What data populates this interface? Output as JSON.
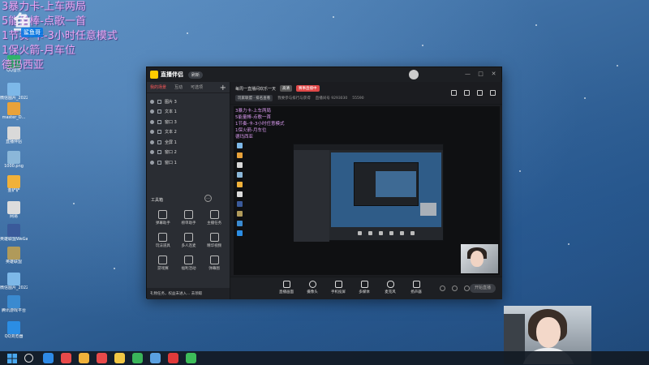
{
  "overlay": {
    "lines": [
      "3暴力卡-上车两局",
      "5能量棒-点歌一首",
      "1节奏-卡-3小时任意模式",
      "1保火箭-月车位",
      "德玛西亚"
    ],
    "logo_text": "鱼",
    "logo_tag": "鲨鱼哥"
  },
  "desktop_icons": [
    {
      "label": "QQ音乐",
      "color": "#2fb36b"
    },
    {
      "label": "微信图片_20220...",
      "color": "#7db8e8"
    },
    {
      "label": "master_D...",
      "color": "#e8a23a"
    },
    {
      "label": "直播伴侣",
      "color": "#d9d9d9"
    },
    {
      "label": "1000.png",
      "color": "#8bb7d9"
    },
    {
      "label": "金铲铲",
      "color": "#f0b13a"
    },
    {
      "label": "网易",
      "color": "#dcdcdc"
    },
    {
      "label": "英雄联盟WeGame版",
      "color": "#3a5a9a"
    },
    {
      "label": "英雄联盟",
      "color": "#b09a5a"
    },
    {
      "label": "微信图片_20220...",
      "color": "#7db8e8"
    },
    {
      "label": "腾讯游戏平台",
      "color": "#3a8ad0"
    },
    {
      "label": "QQ浏览器",
      "color": "#2b8de4"
    }
  ],
  "app": {
    "name": "直播伴侣",
    "badge": "刷新",
    "window_buttons": [
      "—",
      "□",
      "✕"
    ],
    "side_tabs": [
      "我的场景",
      "互动",
      "可选项"
    ],
    "scenes": [
      "图片 3",
      "文本 1",
      "窗口 3",
      "文本 2",
      "全屏 1",
      "窗口 2",
      "窗口 1"
    ],
    "tools_heading": "工具箱",
    "tools": [
      "弹幕助手",
      "榜单助手",
      "主播任务",
      "玩法道具",
      "多人连麦",
      "精华视频",
      "游戏赛",
      "福利活动",
      "弹幕图"
    ],
    "side_footer": "礼物任务，权益未进入... 去领取",
    "title": "每周一直播间欢乐一天",
    "title_pill_red": "高清",
    "title_pill_gray": "赛事直播中",
    "sub_items": [
      "玩家联盟 · 排名查看",
      "我要参与排行与获得",
      "直播间号 9293030",
      "55590"
    ],
    "canvas_overlay": [
      "3暴力卡-上车两局",
      "5能量棒-点歌一首",
      "1节奏-卡-3小时任意模式",
      "1保火箭-月车位",
      "德玛西亚"
    ],
    "toolbar": [
      "直播画面",
      "摄像头",
      "手机投屏",
      "多媒体",
      "麦克风",
      "扬声器"
    ],
    "live_button": "开始直播"
  },
  "taskbar": {
    "apps": [
      {
        "name": "browser",
        "color": "#2e8ae6"
      },
      {
        "name": "qq",
        "color": "#e84a4a"
      },
      {
        "name": "game",
        "color": "#f0b13a"
      },
      {
        "name": "netease",
        "color": "#e84a4a"
      },
      {
        "name": "folder",
        "color": "#f2c744"
      },
      {
        "name": "player",
        "color": "#3ab45a"
      },
      {
        "name": "store",
        "color": "#5aa0e0"
      },
      {
        "name": "stream",
        "color": "#e03a3a"
      },
      {
        "name": "wechat",
        "color": "#3dbd5a"
      }
    ]
  }
}
